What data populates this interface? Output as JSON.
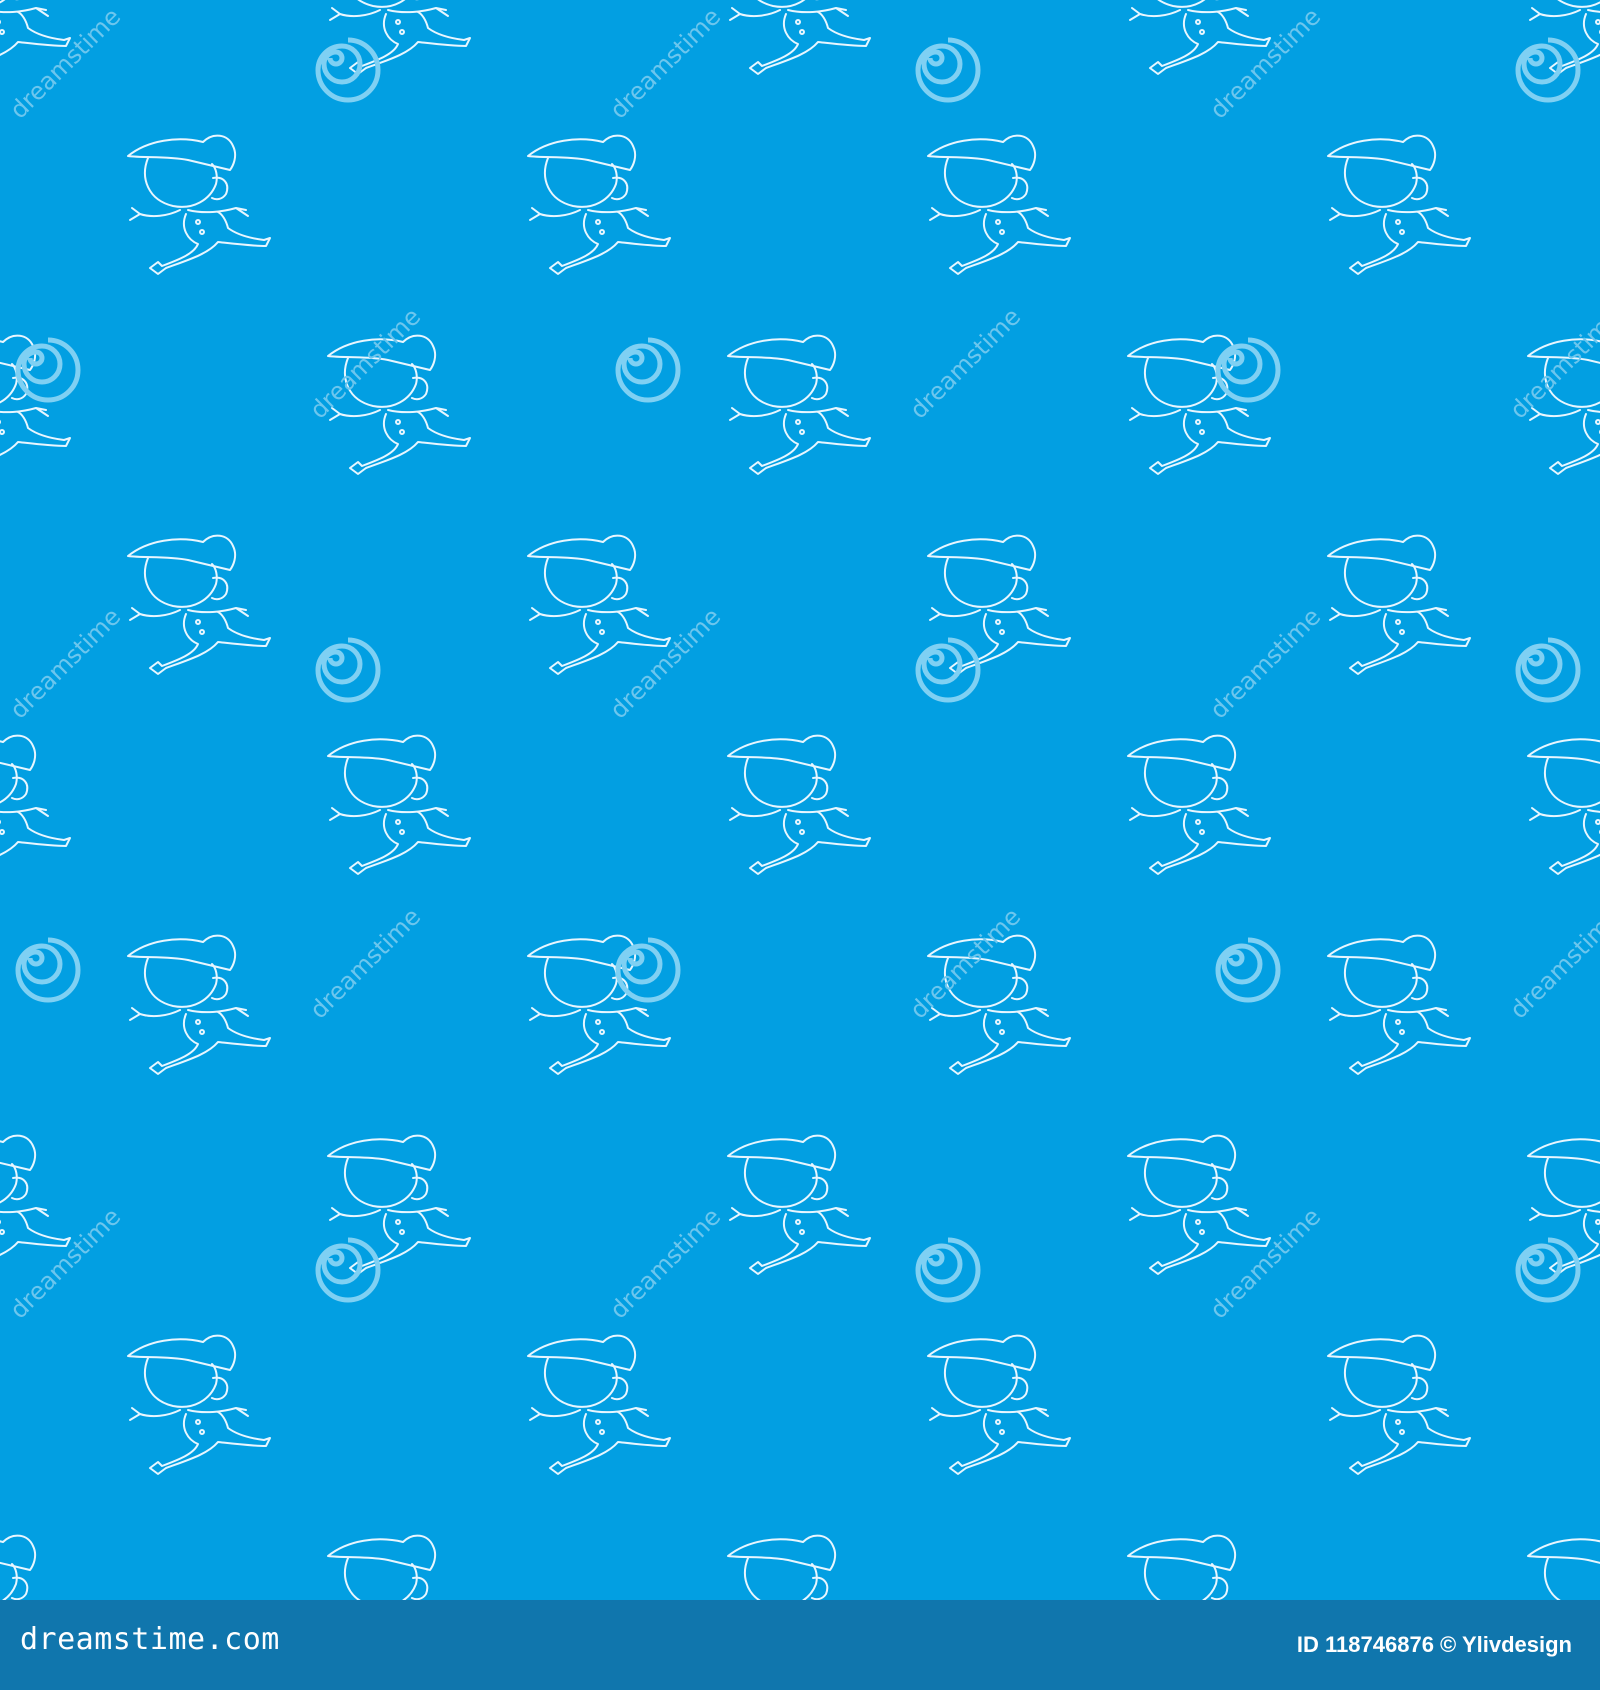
{
  "watermark": {
    "text": "dreamstime"
  },
  "footer": {
    "logo": "dreamstime.com",
    "credit": "ID 118746876 © Ylivdesign"
  },
  "colors": {
    "background": "#029fe2",
    "footer": "#1076ad",
    "line": "#ffffff"
  },
  "icons": {
    "figure": "running-boy-cap-icon",
    "watermark": "spiral-icon"
  }
}
